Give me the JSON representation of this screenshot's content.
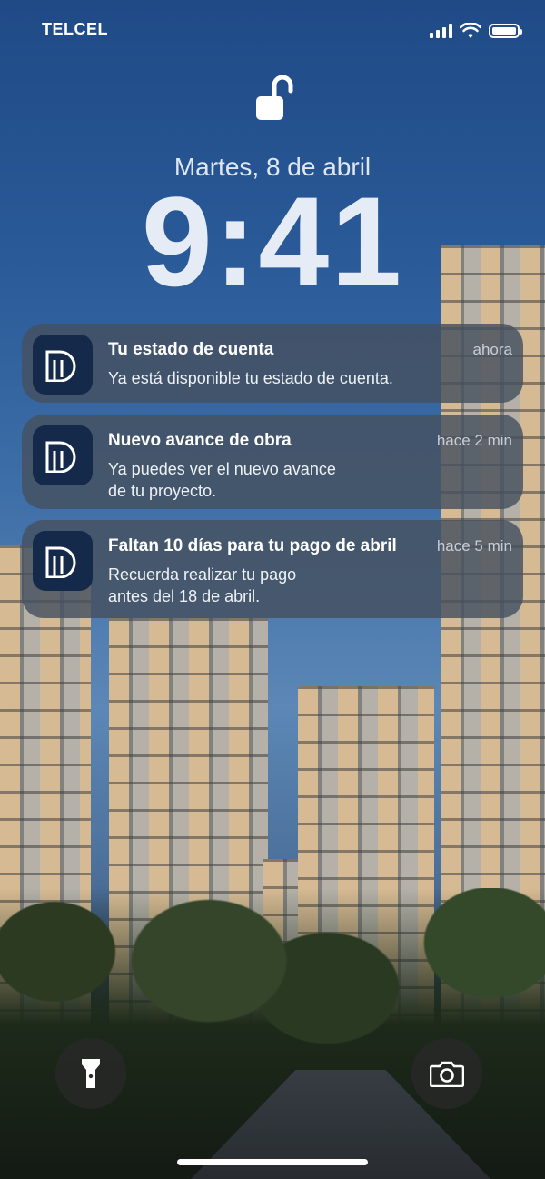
{
  "status_bar": {
    "carrier": "TELCEL",
    "signal_icon": "cellular-signal-icon",
    "wifi_icon": "wifi-icon",
    "battery_icon": "battery-icon"
  },
  "lockscreen": {
    "lock_icon": "unlocked-padlock-icon",
    "date": "Martes, 8 de abril",
    "time": "9:41"
  },
  "notifications": [
    {
      "title": "Tu estado de cuenta",
      "time": "ahora",
      "body": "Ya está disponible tu estado de cuenta.",
      "icon": "app-logo-icon"
    },
    {
      "title": "Nuevo avance de obra",
      "time": "hace 2 min",
      "body_line1": "Ya puedes ver el nuevo avance",
      "body_line2": "de tu proyecto.",
      "icon": "app-logo-icon"
    },
    {
      "title": "Faltan 10 días para tu pago de abril",
      "time": "hace 5 min",
      "body_line1": "Recuerda realizar tu pago",
      "body_line2": "antes del 18 de abril.",
      "icon": "app-logo-icon"
    }
  ],
  "controls": {
    "flashlight": "flashlight-icon",
    "camera": "camera-icon"
  },
  "colors": {
    "app_icon_bg": "#152a4a",
    "notification_bg": "#46505f",
    "text": "#ffffff"
  }
}
